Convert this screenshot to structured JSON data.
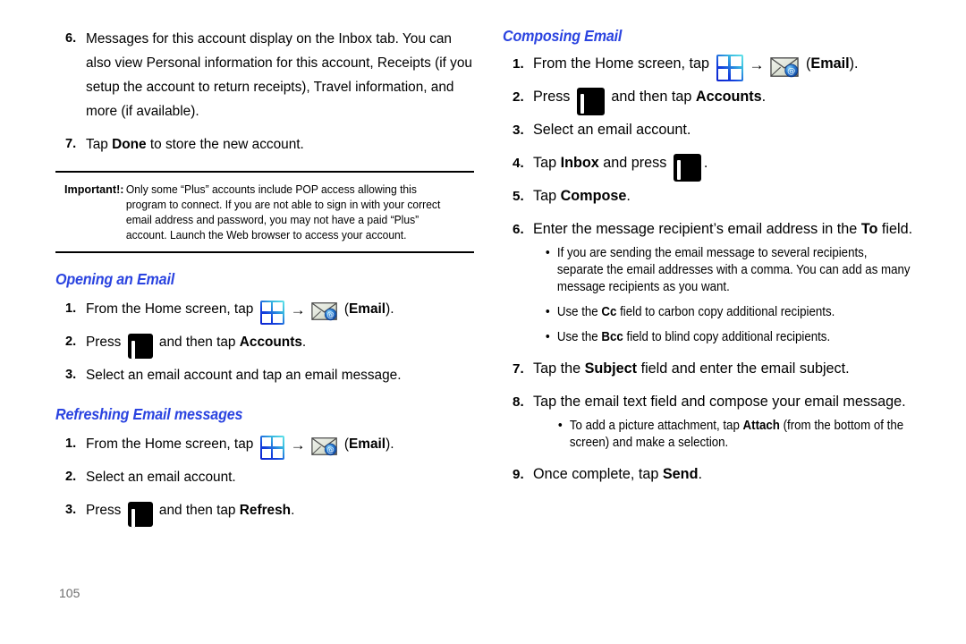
{
  "page": {
    "number": "105"
  },
  "left_column": {
    "continued_steps": [
      {
        "num": "6.",
        "text": "Messages for this account display on the Inbox tab. You can also view Personal information for this account, Receipts (if you setup the account to return receipts), Travel information, and more (if available)."
      }
    ],
    "step7": {
      "num": "7.",
      "prefix": "Tap ",
      "bold": "Done",
      "suffix": " to store the new account."
    },
    "callout": {
      "label": "Important!:",
      "text": "Only some “Plus” accounts include POP access allowing this program to connect. If you are not able to sign in with your correct email address and password, you may not have a paid “Plus” account. Launch the Web browser to access your account."
    },
    "opening_section": {
      "heading": "Opening an Email",
      "step1": {
        "num": "1.",
        "prefix": "From the Home screen, tap ",
        "arrow": "→",
        "suffix_open": " (",
        "bold": "Email",
        "suffix_close": ")."
      },
      "step2": {
        "num": "2.",
        "prefix": "Press ",
        "middle": " and then tap ",
        "bold": "Accounts",
        "suffix": "."
      },
      "step3": {
        "num": "3.",
        "text": "Select an email account and tap an email message."
      }
    },
    "refreshing_section": {
      "heading": "Refreshing Email messages",
      "step1": {
        "num": "1.",
        "prefix": "From the Home screen, tap ",
        "arrow": "→",
        "suffix_open": " (",
        "bold": "Email",
        "suffix_close": ")."
      },
      "step2": {
        "num": "2.",
        "text": "Select an email account."
      },
      "step3": {
        "num": "3.",
        "prefix": "Press ",
        "middle": " and then tap ",
        "bold": "Refresh",
        "suffix": "."
      }
    }
  },
  "right_column": {
    "composing_section": {
      "heading": "Composing Email",
      "step1": {
        "num": "1.",
        "prefix": "From the Home screen, tap ",
        "arrow": "→",
        "suffix_open": " (",
        "bold": "Email",
        "suffix_close": ")."
      },
      "step2": {
        "num": "2.",
        "prefix": "Press ",
        "middle": " and then tap ",
        "bold": "Accounts",
        "suffix": "."
      },
      "step3": {
        "num": "3.",
        "text": "Select an email account."
      },
      "step4": {
        "num": "4.",
        "prefix": "Tap ",
        "bold": "Inbox",
        "middle": " and press ",
        "suffix": "."
      },
      "step5": {
        "num": "5.",
        "prefix": "Tap ",
        "bold": "Compose",
        "suffix": "."
      },
      "step6": {
        "num": "6.",
        "prefix": "Enter the message recipient’s email address in the ",
        "bold": "To",
        "suffix": " field."
      },
      "step6_bullets": [
        {
          "text": "If you are sending the email message to several recipients, separate the email addresses with a comma. You can add as many message recipients as you want."
        },
        {
          "prefix": "Use the ",
          "bold": "Cc",
          "suffix": " field to carbon copy additional recipients."
        },
        {
          "prefix": "Use the ",
          "bold": "Bcc",
          "suffix": " field to blind copy additional recipients."
        }
      ],
      "step7": {
        "num": "7.",
        "prefix": "Tap the ",
        "bold": "Subject",
        "suffix": " field and enter the email subject."
      },
      "step8": {
        "num": "8.",
        "text": "Tap the email text field and compose your email message."
      },
      "step8_bullet": {
        "prefix": "To add a picture attachment, tap ",
        "bold": "Attach",
        "suffix": " (from the bottom of the screen) and make a selection."
      },
      "step9": {
        "num": "9.",
        "prefix": "Once complete, tap ",
        "bold": "Send",
        "suffix": "."
      }
    }
  },
  "icons": {
    "apps_grid": "apps-grid-icon",
    "arrow": "arrow-right-icon",
    "email": "email-envelope-icon",
    "menu_key": "menu-key-icon"
  },
  "colors": {
    "heading_blue": "#2b44e0",
    "page_number_grey": "#6d6d6d",
    "rule_black": "#000000"
  }
}
